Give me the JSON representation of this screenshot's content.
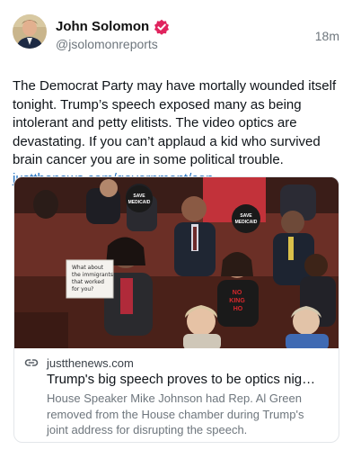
{
  "author": {
    "display_name": "John Solomon",
    "handle": "@jsolomonreports",
    "verified": true,
    "avatar_icon": "avatar-photo"
  },
  "post": {
    "time": "18m",
    "text": "The Democrat Party may have mortally wounded itself tonight. Trump’s speech exposed many as being intolerant and petty elitists. The video optics are devastating. If you can’t applaud a kid who survived brain cancer you are in some political trouble.",
    "link_text": "justthenews.com/government/con…"
  },
  "card": {
    "image_icon": "news-photo",
    "image_text": {
      "sign1": "SAVE\nMEDICAID",
      "sign2": "SAVE\nMEDICAID",
      "handwritten_sign": "What about\nthe immigrants\nthat worked\nfor you?",
      "shirt": "NO\nKING\nHO"
    },
    "domain_icon": "link-icon",
    "domain": "justthenews.com",
    "title": "Trump's big speech proves to be optics nightm...",
    "description": "House Speaker Mike Johnson had Rep. Al Green removed from the House chamber during Trump's joint address for disrupting the speech."
  },
  "colors": {
    "verified_badge": "#e0245e",
    "link": "#1f6fbf",
    "muted": "#6e767d"
  }
}
